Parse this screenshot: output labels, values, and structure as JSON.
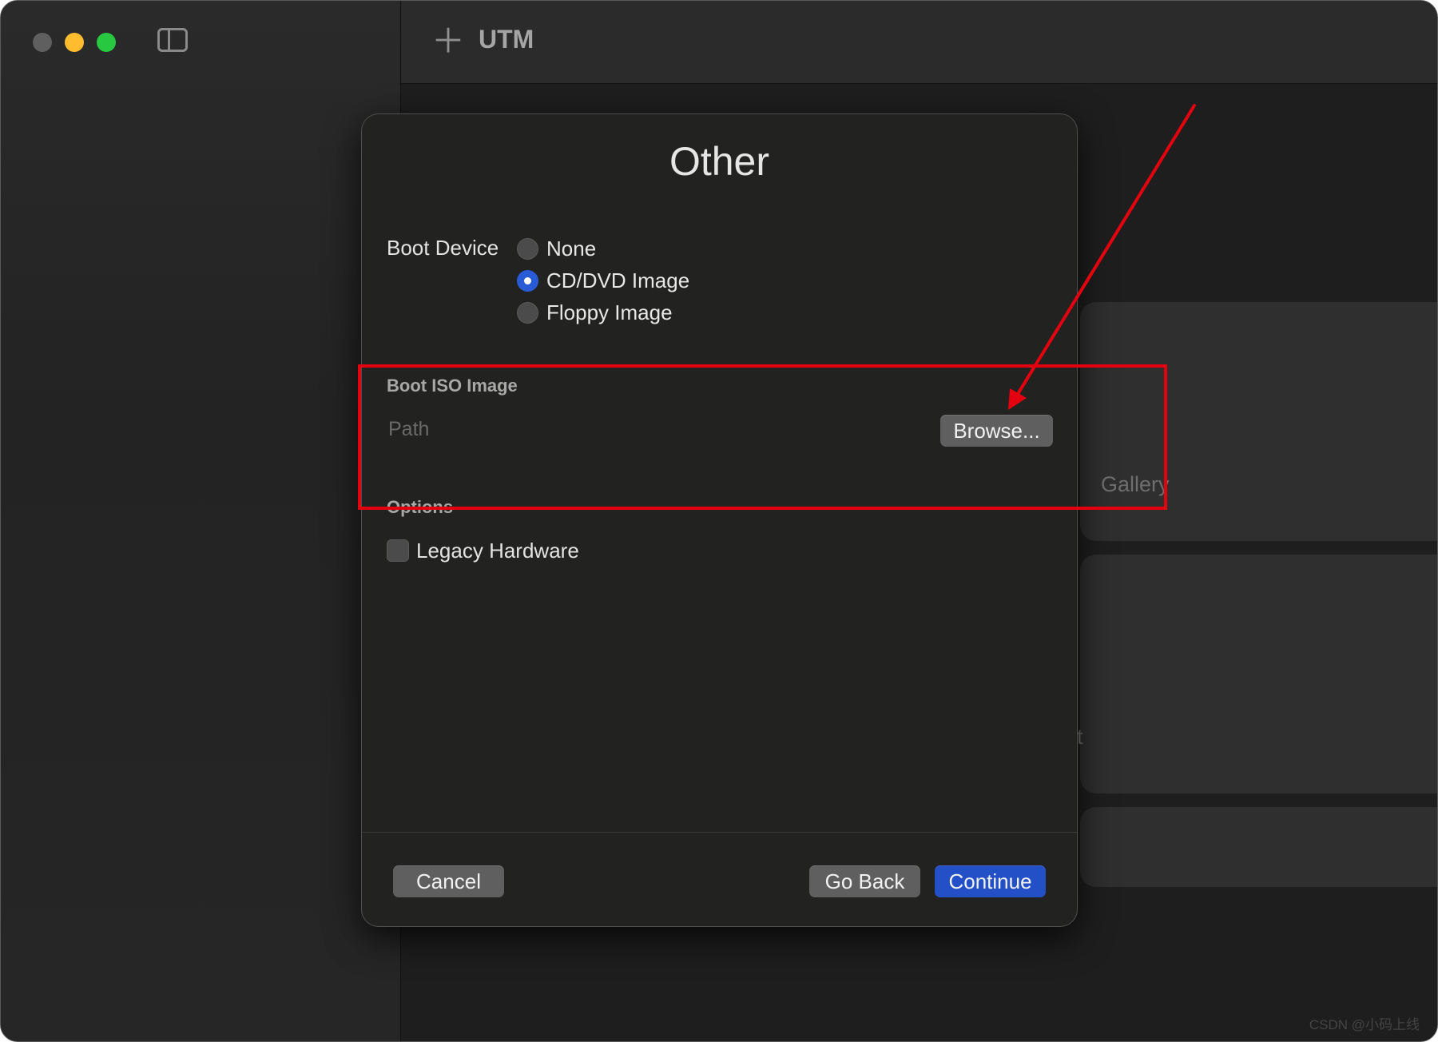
{
  "window": {
    "app_title": "UTM"
  },
  "background_cards": {
    "gallery_label": "Gallery",
    "partial_label": "t"
  },
  "dialog": {
    "title": "Other",
    "boot_device": {
      "label": "Boot Device",
      "options": [
        {
          "label": "None",
          "selected": false
        },
        {
          "label": "CD/DVD Image",
          "selected": true
        },
        {
          "label": "Floppy Image",
          "selected": false
        }
      ]
    },
    "boot_iso": {
      "header": "Boot ISO Image",
      "path_placeholder": "Path",
      "browse_label": "Browse..."
    },
    "options": {
      "header": "Options",
      "legacy_hardware_label": "Legacy Hardware",
      "legacy_hardware_checked": false
    },
    "buttons": {
      "cancel": "Cancel",
      "go_back": "Go Back",
      "continue": "Continue"
    }
  },
  "colors": {
    "accent": "#2350c6",
    "annotation": "#e3000f",
    "traffic_close": "#5f5f5f",
    "traffic_minimize": "#febc2e",
    "traffic_zoom": "#28c840"
  },
  "watermark": "CSDN @小码上线"
}
